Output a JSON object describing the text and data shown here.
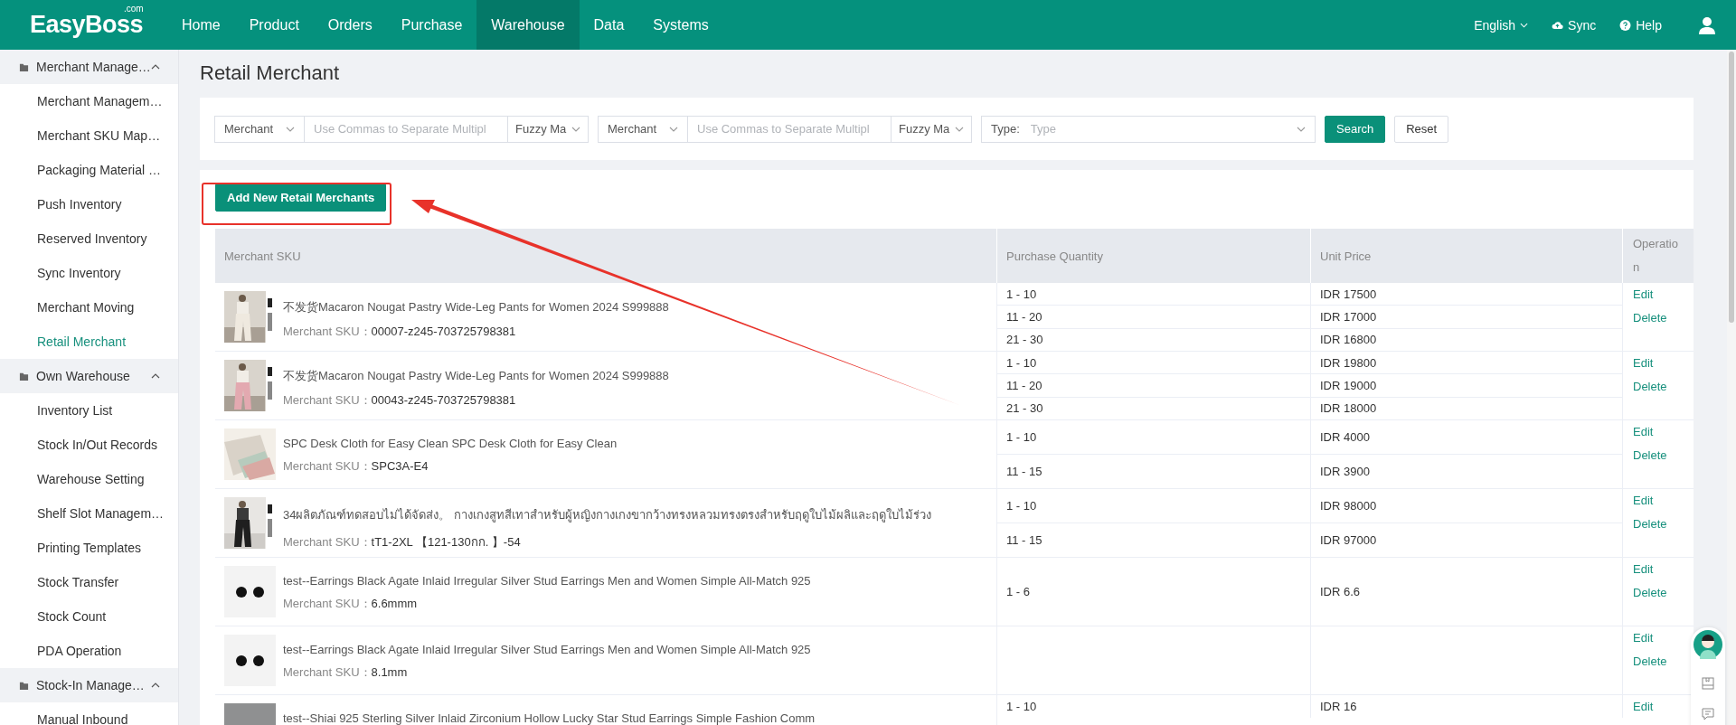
{
  "header": {
    "logo": "EasyBoss",
    "logo_suffix": ".com",
    "nav": [
      {
        "label": "Home",
        "selected": false
      },
      {
        "label": "Product",
        "selected": false
      },
      {
        "label": "Orders",
        "selected": false
      },
      {
        "label": "Purchase",
        "selected": false
      },
      {
        "label": "Warehouse",
        "selected": true
      },
      {
        "label": "Data",
        "selected": false
      },
      {
        "label": "Systems",
        "selected": false
      }
    ],
    "language": "English",
    "sync": "Sync",
    "help": "Help"
  },
  "sidebar": {
    "groups": [
      {
        "label": "Merchant Manage…",
        "expanded": true,
        "children": [
          {
            "label": "Merchant Managem…",
            "selected": false
          },
          {
            "label": "Merchant SKU Map…",
            "selected": false
          },
          {
            "label": "Packaging Material …",
            "selected": false
          },
          {
            "label": "Push Inventory",
            "selected": false
          },
          {
            "label": "Reserved Inventory",
            "selected": false
          },
          {
            "label": "Sync Inventory",
            "selected": false
          },
          {
            "label": "Merchant Moving",
            "selected": false
          },
          {
            "label": "Retail Merchant",
            "selected": true
          }
        ]
      },
      {
        "label": "Own Warehouse",
        "expanded": true,
        "children": [
          {
            "label": "Inventory List",
            "selected": false
          },
          {
            "label": "Stock In/Out Records",
            "selected": false
          },
          {
            "label": "Warehouse Setting",
            "selected": false
          },
          {
            "label": "Shelf Slot Managem…",
            "selected": false
          },
          {
            "label": "Printing Templates",
            "selected": false
          },
          {
            "label": "Stock Transfer",
            "selected": false
          },
          {
            "label": "Stock Count",
            "selected": false
          },
          {
            "label": "PDA Operation",
            "selected": false
          }
        ]
      },
      {
        "label": "Stock-In Manage…",
        "expanded": true,
        "children": [
          {
            "label": "Manual Inbound",
            "selected": false
          }
        ]
      }
    ]
  },
  "page_title": "Retail Merchant",
  "filters": {
    "groups": [
      {
        "field": "Merchant",
        "placeholder": "Use Commas to Separate Multipl",
        "match": "Fuzzy Ma"
      },
      {
        "field": "Merchant",
        "placeholder": "Use Commas to Separate Multipl",
        "match": "Fuzzy Ma"
      }
    ],
    "type_label": "Type:",
    "type_placeholder": "Type",
    "search": "Search",
    "reset": "Reset"
  },
  "add_button": "Add New Retail Merchants",
  "table": {
    "columns": [
      "Merchant SKU",
      "Purchase Quantity",
      "Unit Price",
      "Operation"
    ],
    "rows": [
      {
        "title": "不发货Macaron Nougat Pastry Wide-Leg Pants for Women 2024 S999888",
        "sku_label": "Merchant SKU：",
        "sku": "00007-z245-703725798381",
        "tiers": [
          {
            "qty": "1 - 10",
            "price": "IDR 17500"
          },
          {
            "qty": "11 - 20",
            "price": "IDR 17000"
          },
          {
            "qty": "21 - 30",
            "price": "IDR 16800"
          }
        ],
        "actions": [
          "Edit",
          "Delete"
        ]
      },
      {
        "title": "不发货Macaron Nougat Pastry Wide-Leg Pants for Women 2024 S999888",
        "sku_label": "Merchant SKU：",
        "sku": "00043-z245-703725798381",
        "tiers": [
          {
            "qty": "1 - 10",
            "price": "IDR 19800"
          },
          {
            "qty": "11 - 20",
            "price": "IDR 19000"
          },
          {
            "qty": "21 - 30",
            "price": "IDR 18000"
          }
        ],
        "actions": [
          "Edit",
          "Delete"
        ]
      },
      {
        "title": "SPC Desk Cloth for Easy Clean  SPC Desk Cloth for Easy Clean",
        "sku_label": "Merchant SKU：",
        "sku": "SPC3A-E4",
        "tiers": [
          {
            "qty": "1 - 10",
            "price": "IDR 4000"
          },
          {
            "qty": "11 - 15",
            "price": "IDR 3900"
          }
        ],
        "actions": [
          "Edit",
          "Delete"
        ]
      },
      {
        "title": "34ผลิตภัณฑ์ทดสอบไม่ได้จัดส่ง。 กางเกงสูทสีเทาสำหรับผู้หญิงกางเกงขากว้างทรงหลวมทรงตรงสำหรับฤดูใบไม้ผลิและฤดูใบไม้ร่วง",
        "sku_label": "Merchant SKU：",
        "sku": "tT1-2XL 【121-130กก. 】-54",
        "tiers": [
          {
            "qty": "1 - 10",
            "price": "IDR 98000"
          },
          {
            "qty": "11 - 15",
            "price": "IDR 97000"
          }
        ],
        "actions": [
          "Edit",
          "Delete"
        ]
      },
      {
        "title": "test--Earrings Black Agate Inlaid Irregular Silver Stud Earrings Men and Women Simple All-Match 925",
        "sku_label": "Merchant SKU：",
        "sku": "6.6mmm",
        "tiers": [
          {
            "qty": "1 - 6",
            "price": "IDR 6.6"
          }
        ],
        "actions": [
          "Edit",
          "Delete"
        ]
      },
      {
        "title": "test--Earrings Black Agate Inlaid Irregular Silver Stud Earrings Men and Women Simple All-Match 925",
        "sku_label": "Merchant SKU：",
        "sku": "8.1mm",
        "tiers": [],
        "actions": [
          "Edit",
          "Delete"
        ]
      },
      {
        "title": "test--Shiai 925 Sterling Silver Inlaid Zirconium Hollow Lucky Star Stud Earrings Simple Fashion Comm",
        "tiers": [
          {
            "qty": "1 - 10",
            "price": "IDR 16"
          }
        ],
        "actions": [
          "Edit"
        ]
      }
    ]
  }
}
